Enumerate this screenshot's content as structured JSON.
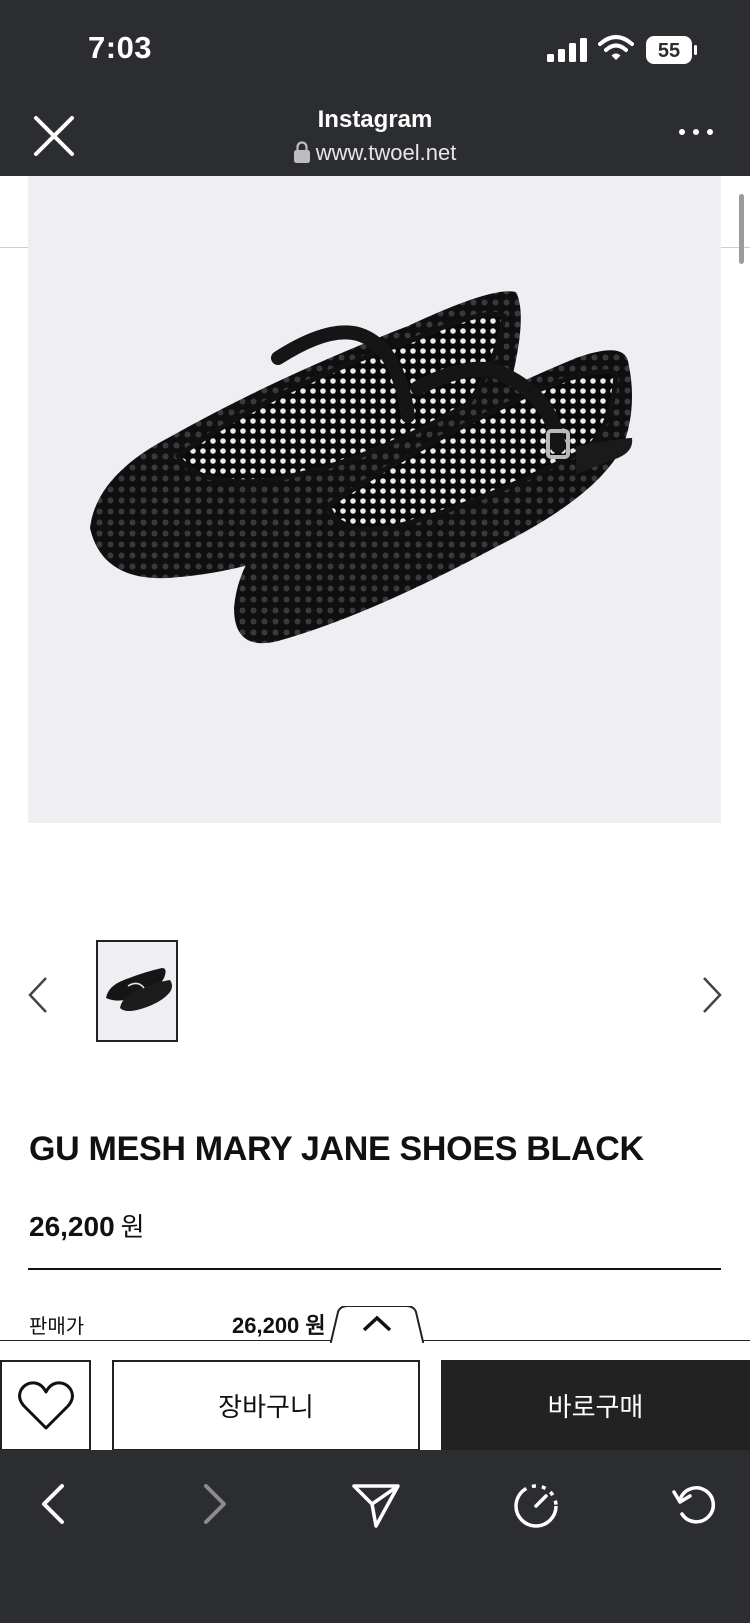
{
  "status_bar": {
    "time": "7:03",
    "battery": "55"
  },
  "browser": {
    "title": "Instagram",
    "url": "www.twoel.net"
  },
  "product": {
    "name": "GU MESH MARY JANE SHOES BLACK",
    "price": "26,200",
    "currency": "원",
    "sale_price_label": "판매가",
    "sale_price_value": "26,200 원"
  },
  "actions": {
    "cart_label": "장바구니",
    "buy_label": "바로구매"
  },
  "icons": {
    "close": "close-icon",
    "more": "more-icon",
    "lock": "lock-icon",
    "prev": "chevron-left-icon",
    "next": "chevron-right-icon",
    "collapse": "chevron-up-icon",
    "wishlist": "heart-icon",
    "back": "back-icon",
    "forward": "forward-icon",
    "share": "send-icon",
    "timer": "timer-icon",
    "reload": "reload-icon"
  },
  "colors": {
    "chrome": "#2b2d30",
    "buy_button": "#222222",
    "image_bg": "#efeff3"
  }
}
